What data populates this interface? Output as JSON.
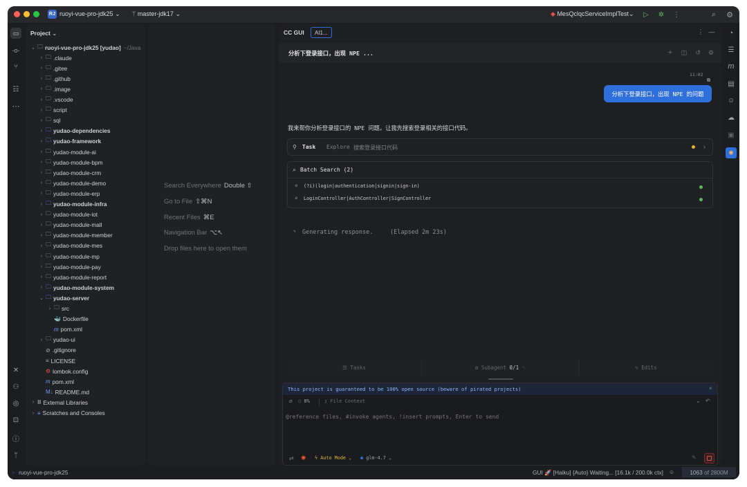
{
  "titlebar": {
    "project_badge": "RJ",
    "project": "ruoyi-vue-pro-jdk25",
    "branch": "master-jdk17",
    "run_config": "MesQclqcServiceImplTest"
  },
  "project_panel": {
    "title": "Project"
  },
  "tree": [
    {
      "label": "ruoyi-vue-pro-jdk25 [yudao]",
      "suffix": "~/Java",
      "d": 0,
      "ch": "v",
      "i": "folder",
      "b": true
    },
    {
      "label": ".claude",
      "d": 1,
      "ch": ">",
      "i": "folder"
    },
    {
      "label": ".gitee",
      "d": 1,
      "ch": ">",
      "i": "folder"
    },
    {
      "label": ".github",
      "d": 1,
      "ch": ">",
      "i": "folder"
    },
    {
      "label": ".image",
      "d": 1,
      "ch": ">",
      "i": "folder"
    },
    {
      "label": ".vscode",
      "d": 1,
      "ch": ">",
      "i": "folder"
    },
    {
      "label": "script",
      "d": 1,
      "ch": ">",
      "i": "folder"
    },
    {
      "label": "sql",
      "d": 1,
      "ch": ">",
      "i": "folder"
    },
    {
      "label": "yudao-dependencies",
      "d": 1,
      "ch": ">",
      "i": "module",
      "b": true
    },
    {
      "label": "yudao-framework",
      "d": 1,
      "ch": ">",
      "i": "module",
      "b": true
    },
    {
      "label": "yudao-module-ai",
      "d": 1,
      "ch": ">",
      "i": "folder"
    },
    {
      "label": "yudao-module-bpm",
      "d": 1,
      "ch": ">",
      "i": "folder"
    },
    {
      "label": "yudao-module-crm",
      "d": 1,
      "ch": ">",
      "i": "folder"
    },
    {
      "label": "yudao-module-demo",
      "d": 1,
      "ch": ">",
      "i": "folder"
    },
    {
      "label": "yudao-module-erp",
      "d": 1,
      "ch": ">",
      "i": "folder"
    },
    {
      "label": "yudao-module-infra",
      "d": 1,
      "ch": ">",
      "i": "module",
      "b": true
    },
    {
      "label": "yudao-module-iot",
      "d": 1,
      "ch": ">",
      "i": "folder"
    },
    {
      "label": "yudao-module-mall",
      "d": 1,
      "ch": ">",
      "i": "folder"
    },
    {
      "label": "yudao-module-member",
      "d": 1,
      "ch": ">",
      "i": "folder"
    },
    {
      "label": "yudao-module-mes",
      "d": 1,
      "ch": ">",
      "i": "folder"
    },
    {
      "label": "yudao-module-mp",
      "d": 1,
      "ch": ">",
      "i": "folder"
    },
    {
      "label": "yudao-module-pay",
      "d": 1,
      "ch": ">",
      "i": "folder"
    },
    {
      "label": "yudao-module-report",
      "d": 1,
      "ch": ">",
      "i": "folder"
    },
    {
      "label": "yudao-module-system",
      "d": 1,
      "ch": ">",
      "i": "module",
      "b": true
    },
    {
      "label": "yudao-server",
      "d": 1,
      "ch": "v",
      "i": "module",
      "b": true
    },
    {
      "label": "src",
      "d": 2,
      "ch": ">",
      "i": "folder"
    },
    {
      "label": "Dockerfile",
      "d": 2,
      "ch": "",
      "i": "docker"
    },
    {
      "label": "pom.xml",
      "d": 2,
      "ch": "",
      "i": "maven"
    },
    {
      "label": "yudao-ui",
      "d": 1,
      "ch": ">",
      "i": "folder"
    },
    {
      "label": ".gitignore",
      "d": 1,
      "ch": "",
      "i": "ignore"
    },
    {
      "label": "LICENSE",
      "d": 1,
      "ch": "",
      "i": "text"
    },
    {
      "label": "lombok.config",
      "d": 1,
      "ch": "",
      "i": "config"
    },
    {
      "label": "pom.xml",
      "d": 1,
      "ch": "",
      "i": "maven"
    },
    {
      "label": "README.md",
      "d": 1,
      "ch": "",
      "i": "md"
    },
    {
      "label": "External Libraries",
      "d": 0,
      "ch": ">",
      "i": "lib"
    },
    {
      "label": "Scratches and Consoles",
      "d": 0,
      "ch": ">",
      "i": "scratch"
    }
  ],
  "editor_hints": [
    {
      "text": "Search Everywhere",
      "key": "Double ⇧"
    },
    {
      "text": "Go to File",
      "key": "⇧⌘N"
    },
    {
      "text": "Recent Files",
      "key": "⌘E"
    },
    {
      "text": "Navigation Bar",
      "key": "⌥↖"
    },
    {
      "text": "Drop files here to open them",
      "key": ""
    }
  ],
  "ccgui": {
    "title": "CC GUI",
    "tab": "AI1...",
    "session_title": "分析下登录接口，出现 NPE ...",
    "msg_time": "11:02",
    "user_msg": "分析下登录接口，出现 NPE 的问题",
    "assistant_msg": "我来帮你分析登录接口的 NPE 问题。让我先搜索登录相关的接口代码。",
    "task": {
      "label": "Task",
      "agent": "Explore",
      "desc": "搜索登录接口代码"
    },
    "batch": {
      "title": "Batch Search (2)",
      "items": [
        "(?i)(login|authentication|signin|sign-in)",
        "LoginController|AuthController|SignController"
      ]
    },
    "generating": "Generating response.",
    "elapsed": "(Elapsed 2m 23s)",
    "tabs": {
      "tasks": "Tasks",
      "subagent": "Subagent",
      "subagent_count": "0/1",
      "edits": "Edits"
    },
    "notice": "This project is guaranteed to be 100% open source (beware of pirated projects)",
    "progress_pct": "8%",
    "file_context": "File Context",
    "input_placeholder": "@reference files, #invoke agents, !insert prompts, Enter to send",
    "mode": "Auto Mode",
    "model": "glm-4.7"
  },
  "status": {
    "path": "ruoyi-vue-pro-jdk25",
    "right": "GUI 🚀 [Haiku] {Auto} Waiting... [16.1k / 200.0k ctx]",
    "mem_used": "1063",
    "mem_total": "of 2800M"
  },
  "colors": {
    "accent": "#2f6fdb",
    "warning": "#e0b43a",
    "success": "#5fb65a",
    "stop": "#d9534f"
  }
}
